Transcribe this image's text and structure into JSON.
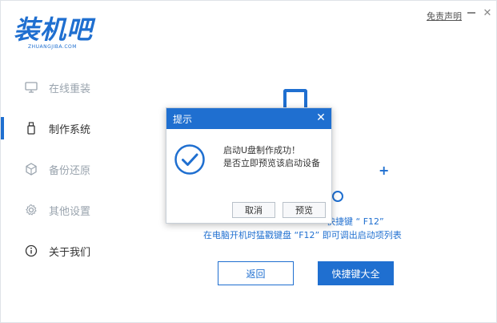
{
  "window": {
    "disclaimer_label": "免责声明",
    "minimize_icon": "minimize-icon",
    "close_icon": "close-icon"
  },
  "brand": {
    "logo_text": "装机吧",
    "logo_sub": "ZHUANGJIBA.COM",
    "accent": "#1f6fd0"
  },
  "sidebar": {
    "items": [
      {
        "label": "在线重装",
        "icon": "monitor-icon",
        "active": false
      },
      {
        "label": "制作系统",
        "icon": "usb-drive-icon",
        "active": true
      },
      {
        "label": "备份还原",
        "icon": "cube-icon",
        "active": false
      },
      {
        "label": "其他设置",
        "icon": "gear-icon",
        "active": false
      },
      {
        "label": "关于我们",
        "icon": "info-icon",
        "active": false
      }
    ]
  },
  "main": {
    "hint_line1": "快捷键 “ F12”",
    "hint_line2": "在电脑开机时猛戳键盘 “F12” 即可调出启动项列表",
    "back_button": "返回",
    "hotkeys_button": "快捷键大全"
  },
  "dialog": {
    "title": "提示",
    "message_line1": "启动U盘制作成功！",
    "message_line2": "是否立即预览该启动设备",
    "cancel_button": "取消",
    "preview_button": "预览",
    "icon": "check-circle-icon"
  }
}
